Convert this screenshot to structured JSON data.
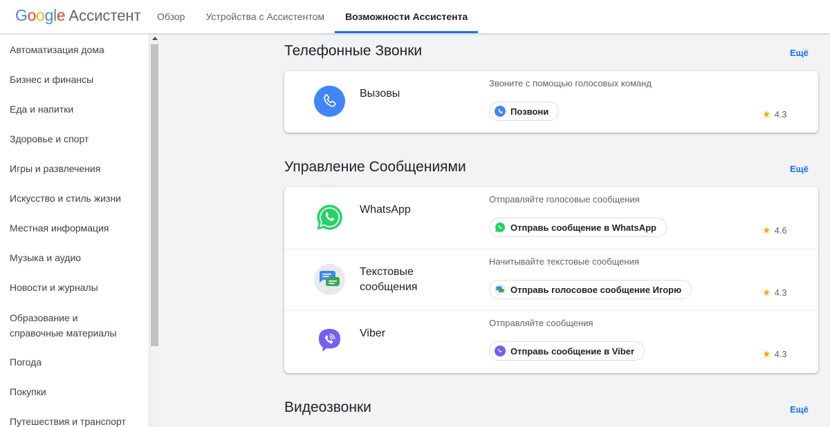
{
  "header": {
    "logo_word": "Google",
    "logo_product": "Ассистент",
    "tabs": [
      {
        "label": "Обзор"
      },
      {
        "label": "Устройства с Ассистентом"
      },
      {
        "label": "Возможности Ассистента"
      }
    ],
    "active_tab_color": "#1a73e8"
  },
  "sidebar": {
    "items": [
      {
        "label": "Автоматизация дома"
      },
      {
        "label": "Бизнес и финансы"
      },
      {
        "label": "Еда и напитки"
      },
      {
        "label": "Здоровье и спорт"
      },
      {
        "label": "Игры и развлечения"
      },
      {
        "label": "Искусство и стиль жизни"
      },
      {
        "label": "Местная информация"
      },
      {
        "label": "Музыка и аудио"
      },
      {
        "label": "Новости и журналы"
      },
      {
        "label": "Образование и справочные материалы"
      },
      {
        "label": "Погода"
      },
      {
        "label": "Покупки"
      },
      {
        "label": "Путешествия и транспорт"
      }
    ]
  },
  "sections": [
    {
      "title": "Телефонные Звонки",
      "more_label": "Ещё",
      "apps": [
        {
          "name": "Вызовы",
          "description": "Звоните с помощью голосовых команд",
          "chip": "Позвони",
          "rating": "4.3",
          "icon": "phone-icon"
        }
      ]
    },
    {
      "title": "Управление Сообщениями",
      "more_label": "Ещё",
      "apps": [
        {
          "name": "WhatsApp",
          "description": "Отправляйте голосовые сообщения",
          "chip": "Отправь сообщение в WhatsApp",
          "rating": "4.6",
          "icon": "whatsapp-icon"
        },
        {
          "name": "Текстовые сообщения",
          "description": "Начитывайте текстовые сообщения",
          "chip": "Отправь голосовое сообщение Игорю",
          "rating": "4.3",
          "icon": "messages-icon"
        },
        {
          "name": "Viber",
          "description": "Отправляйте сообщения",
          "chip": "Отправь сообщение в Viber",
          "rating": "4.3",
          "icon": "viber-icon"
        }
      ]
    },
    {
      "title": "Видеозвонки",
      "more_label": "Ещё",
      "apps": []
    }
  ],
  "colors": {
    "accent": "#1a73e8",
    "star": "#f9ab00",
    "whatsapp": "#25d366",
    "viber": "#7360f2",
    "phone": "#4285f4"
  }
}
